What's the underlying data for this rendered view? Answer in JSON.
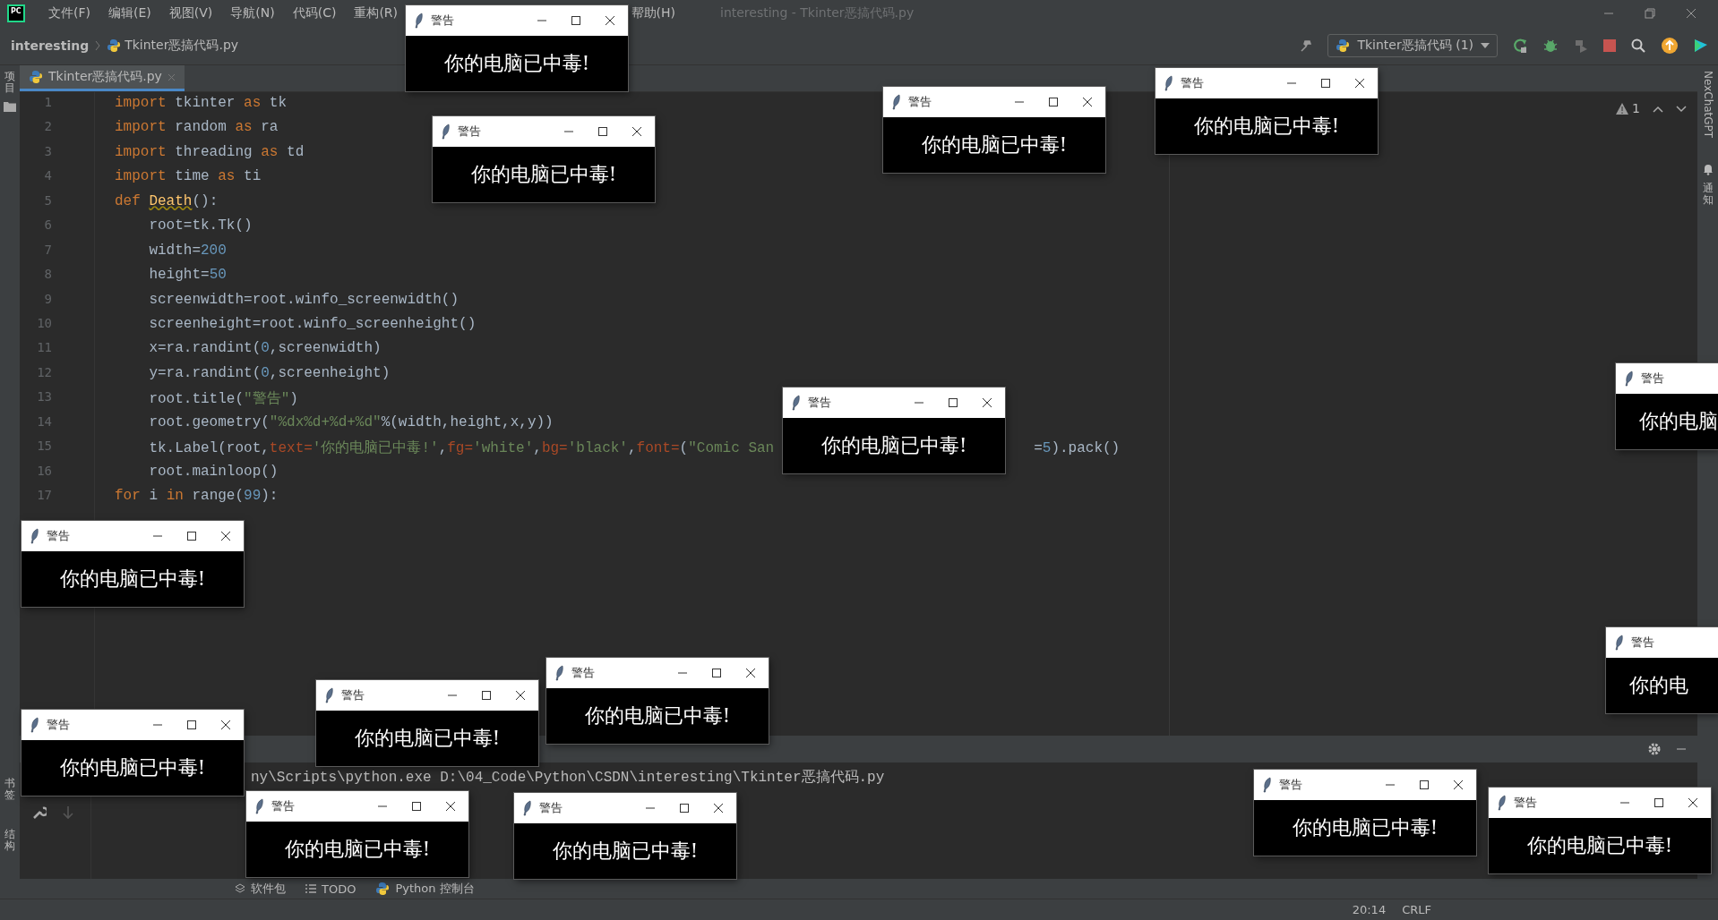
{
  "app_logo": {
    "text": "PC"
  },
  "menu": [
    {
      "label": "文件(F)"
    },
    {
      "label": "编辑(E)"
    },
    {
      "label": "视图(V)"
    },
    {
      "label": "导航(N)"
    },
    {
      "label": "代码(C)"
    },
    {
      "label": "重构(R)"
    },
    {
      "label": "帮助(H)"
    }
  ],
  "window": {
    "title": "interesting - Tkinter恶搞代码.py"
  },
  "breadcrumb": [
    {
      "label": "interesting",
      "kind": "folder"
    },
    {
      "label": "Tkinter恶搞代码.py",
      "kind": "file"
    }
  ],
  "run_config": {
    "label": "Tkinter恶搞代码 (1)"
  },
  "left_stripe": {
    "top": "项目",
    "bottom": [
      "书签",
      "结构"
    ]
  },
  "right_stripe": {
    "top": "NexChatGPT",
    "bottom": "通知"
  },
  "editor_tabs": [
    {
      "label": "Tkinter恶搞代码.py",
      "selected": true
    }
  ],
  "inspection": {
    "count": "1"
  },
  "code_lines": [
    {
      "number": "1",
      "tokens": [
        {
          "kind": "keyword",
          "text": "import"
        },
        {
          "kind": "plain",
          "text": " tkinter "
        },
        {
          "kind": "keyword",
          "text": "as"
        },
        {
          "kind": "plain",
          "text": " tk"
        }
      ]
    },
    {
      "number": "2",
      "tokens": [
        {
          "kind": "keyword",
          "text": "import"
        },
        {
          "kind": "plain",
          "text": " random "
        },
        {
          "kind": "keyword",
          "text": "as"
        },
        {
          "kind": "plain",
          "text": " ra"
        }
      ]
    },
    {
      "number": "3",
      "tokens": [
        {
          "kind": "keyword",
          "text": "import"
        },
        {
          "kind": "plain",
          "text": " threading "
        },
        {
          "kind": "keyword",
          "text": "as"
        },
        {
          "kind": "plain",
          "text": " td"
        }
      ]
    },
    {
      "number": "4",
      "tokens": [
        {
          "kind": "keyword",
          "text": "import"
        },
        {
          "kind": "plain",
          "text": " time "
        },
        {
          "kind": "keyword",
          "text": "as"
        },
        {
          "kind": "plain",
          "text": " ti"
        }
      ]
    },
    {
      "number": "5",
      "tokens": [
        {
          "kind": "keyword",
          "text": "def "
        },
        {
          "kind": "function",
          "text": "Death"
        },
        {
          "kind": "plain",
          "text": "():"
        }
      ]
    },
    {
      "number": "6",
      "tokens": [
        {
          "kind": "plain",
          "text": "    root=tk.Tk()"
        }
      ]
    },
    {
      "number": "7",
      "tokens": [
        {
          "kind": "plain",
          "text": "    width="
        },
        {
          "kind": "number",
          "text": "200"
        }
      ]
    },
    {
      "number": "8",
      "tokens": [
        {
          "kind": "plain",
          "text": "    height="
        },
        {
          "kind": "number",
          "text": "50"
        }
      ]
    },
    {
      "number": "9",
      "tokens": [
        {
          "kind": "plain",
          "text": "    screenwidth=root.winfo_screenwidth()"
        }
      ]
    },
    {
      "number": "10",
      "tokens": [
        {
          "kind": "plain",
          "text": "    screenheight=root.winfo_screenheight()"
        }
      ]
    },
    {
      "number": "11",
      "tokens": [
        {
          "kind": "plain",
          "text": "    x=ra.randint("
        },
        {
          "kind": "number",
          "text": "0"
        },
        {
          "kind": "plain",
          "text": ",screenwidth)"
        }
      ]
    },
    {
      "number": "12",
      "tokens": [
        {
          "kind": "plain",
          "text": "    y=ra.randint("
        },
        {
          "kind": "number",
          "text": "0"
        },
        {
          "kind": "plain",
          "text": ",screenheight)"
        }
      ]
    },
    {
      "number": "13",
      "tokens": [
        {
          "kind": "plain",
          "text": "    root.title("
        },
        {
          "kind": "string",
          "text": "\"警告\""
        },
        {
          "kind": "plain",
          "text": ")"
        }
      ]
    },
    {
      "number": "14",
      "tokens": [
        {
          "kind": "plain",
          "text": "    root.geometry("
        },
        {
          "kind": "string",
          "text": "\"%dx%d+%d+%d\""
        },
        {
          "kind": "plain",
          "text": "%(width,height,x,y))"
        }
      ]
    },
    {
      "number": "15",
      "tokens": [
        {
          "kind": "plain",
          "text": "    tk.Label(root,"
        },
        {
          "kind": "param",
          "text": "text="
        },
        {
          "kind": "string",
          "text": "'你的电脑已中毒!'"
        },
        {
          "kind": "plain",
          "text": ","
        },
        {
          "kind": "param",
          "text": "fg="
        },
        {
          "kind": "string",
          "text": "'white'"
        },
        {
          "kind": "plain",
          "text": ","
        },
        {
          "kind": "param",
          "text": "bg="
        },
        {
          "kind": "string",
          "text": "'black'"
        },
        {
          "kind": "plain",
          "text": ","
        },
        {
          "kind": "param",
          "text": "font="
        },
        {
          "kind": "plain",
          "text": "("
        },
        {
          "kind": "string",
          "text": "\"Comic San"
        },
        {
          "kind": "gap"
        },
        {
          "kind": "plain",
          "text": "="
        },
        {
          "kind": "number",
          "text": "5"
        },
        {
          "kind": "plain",
          "text": ").pack()"
        }
      ]
    },
    {
      "number": "16",
      "tokens": [
        {
          "kind": "plain",
          "text": "    root.mainloop()"
        }
      ]
    },
    {
      "number": "17",
      "tokens": [
        {
          "kind": "keyword",
          "text": "for"
        },
        {
          "kind": "plain",
          "text": " i "
        },
        {
          "kind": "keyword",
          "text": "in"
        },
        {
          "kind": "plain",
          "text": " range("
        },
        {
          "kind": "number",
          "text": "99"
        },
        {
          "kind": "plain",
          "text": "):"
        }
      ]
    }
  ],
  "terminal": {
    "lines": [
      "ny\\Scripts\\python.exe D:\\04_Code\\Python\\CSDN\\interesting\\Tkinter恶搞代码.py"
    ]
  },
  "tool_tabs": [
    {
      "label": "软件包",
      "kind": "packages"
    },
    {
      "label": "TODO",
      "kind": "todo"
    },
    {
      "label": "Python 控制台",
      "kind": "console"
    }
  ],
  "status_bar": [
    "20:14",
    "CRLF"
  ],
  "popups": [
    {
      "kind": "floating",
      "title": "警告",
      "message": "你的电脑已中毒!"
    },
    {
      "kind": "floating",
      "title": "警告",
      "message": "你的电脑已中毒!"
    },
    {
      "kind": "floating",
      "title": "警告",
      "message": "你的电脑已中毒!"
    },
    {
      "kind": "floating",
      "title": "警告",
      "message": "你的电脑已中毒!"
    },
    {
      "kind": "clipped",
      "title": "警告",
      "message": "你的电脑"
    },
    {
      "kind": "inline",
      "title": "警告",
      "message": "你的电脑已中毒!"
    },
    {
      "kind": "floating",
      "title": "警告",
      "message": "你的电脑已中毒!"
    },
    {
      "kind": "clipped",
      "title": "警告",
      "message": "你的电"
    },
    {
      "kind": "floating",
      "title": "警告",
      "message": "你的电脑已中毒!"
    },
    {
      "kind": "floating",
      "title": "警告",
      "message": "你的电脑已中毒!"
    },
    {
      "kind": "floating",
      "title": "警告",
      "message": "你的电脑已中毒!"
    },
    {
      "kind": "floating",
      "title": "警告",
      "message": "你的电脑已中毒!"
    },
    {
      "kind": "floating",
      "title": "警告",
      "message": "你的电脑已中毒!"
    },
    {
      "kind": "floating",
      "title": "警告",
      "message": "你的电脑已中毒!"
    },
    {
      "kind": "floating",
      "title": "警告",
      "message": "你的电脑已中毒!"
    }
  ]
}
